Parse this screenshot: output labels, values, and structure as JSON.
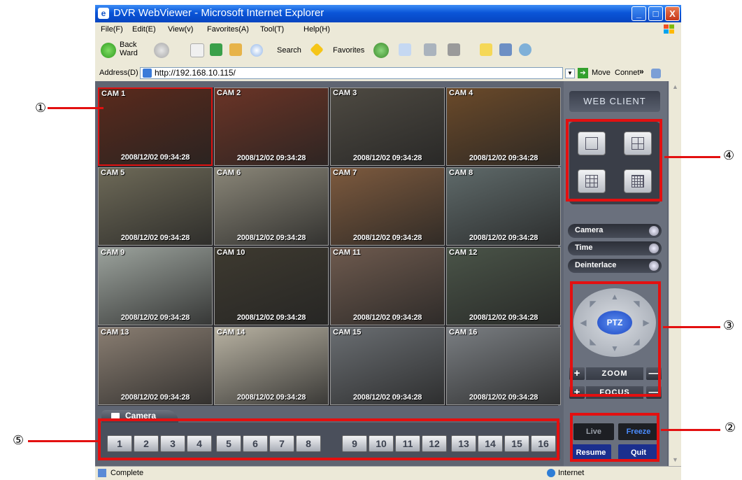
{
  "window": {
    "title": "DVR WebViewer - Microsoft Internet Explorer",
    "buttons": [
      "_",
      "□",
      "X"
    ]
  },
  "menu": [
    "File(F)",
    "Edit(E)",
    "View(v)",
    "Favorites(A)",
    "Tool(T)",
    "Help(H)"
  ],
  "toolbar": {
    "back_label_1": "Back",
    "back_label_2": "Ward",
    "search_label": "Search",
    "favorites_label": "Favorites"
  },
  "address": {
    "label": "Address(D)",
    "url": "http://192.168.10.115/",
    "move_label": "Move",
    "connect_label": "Connet"
  },
  "cameras": [
    {
      "label": "CAM 1",
      "timestamp": "2008/12/02  09:34:28",
      "color": "#5a2a1c"
    },
    {
      "label": "CAM 2",
      "timestamp": "2008/12/02  09:34:28",
      "color": "#6b3426"
    },
    {
      "label": "CAM 3",
      "timestamp": "2008/12/02  09:34:28",
      "color": "#4e4a42"
    },
    {
      "label": "CAM 4",
      "timestamp": "2008/12/02  09:34:28",
      "color": "#6b4a2a"
    },
    {
      "label": "CAM 5",
      "timestamp": "2008/12/02  09:34:28",
      "color": "#6e6a58"
    },
    {
      "label": "CAM 6",
      "timestamp": "2008/12/02  09:34:28",
      "color": "#8a8678"
    },
    {
      "label": "CAM 7",
      "timestamp": "2008/12/02  09:34:28",
      "color": "#7d5a3e"
    },
    {
      "label": "CAM 8",
      "timestamp": "2008/12/02  09:34:28",
      "color": "#5f6a6a"
    },
    {
      "label": "CAM 9",
      "timestamp": "2008/12/02  09:34:28",
      "color": "#9ca39d"
    },
    {
      "label": "CAM 10",
      "timestamp": "2008/12/02  09:34:28",
      "color": "#3e3a30"
    },
    {
      "label": "CAM 11",
      "timestamp": "2008/12/02  09:34:28",
      "color": "#6e5a4e"
    },
    {
      "label": "CAM 12",
      "timestamp": "2008/12/02  09:34:28",
      "color": "#4a5448"
    },
    {
      "label": "CAM 13",
      "timestamp": "2008/12/02  09:34:28",
      "color": "#8a7e72"
    },
    {
      "label": "CAM 14",
      "timestamp": "2008/12/02  09:34:28",
      "color": "#b8b2a2"
    },
    {
      "label": "CAM 15",
      "timestamp": "2008/12/02  09:34:28",
      "color": "#6a6e72"
    },
    {
      "label": "CAM 16",
      "timestamp": "2008/12/02  09:34:28",
      "color": "#7a7e82"
    }
  ],
  "panel": {
    "web_client": "WEB CLIENT",
    "toggles": [
      "Camera",
      "Time",
      "Deinterlace"
    ],
    "ptz": "PTZ",
    "zoom": "ZOOM",
    "focus": "FOCUS",
    "plus": "+",
    "minus": "—",
    "actions": {
      "live": "Live",
      "freeze": "Freeze",
      "resume": "Resume",
      "quit": "Quit"
    },
    "freeze_color": "#4a8cff"
  },
  "camera_bar": {
    "tab_label": "Camera",
    "numbers": [
      "1",
      "2",
      "3",
      "4",
      "5",
      "6",
      "7",
      "8",
      "9",
      "10",
      "11",
      "12",
      "13",
      "14",
      "15",
      "16"
    ]
  },
  "status": {
    "left": "Complete",
    "right": "Internet"
  },
  "callouts": [
    "①",
    "②",
    "③",
    "④",
    "⑤"
  ],
  "highlight_color": "#e31010"
}
